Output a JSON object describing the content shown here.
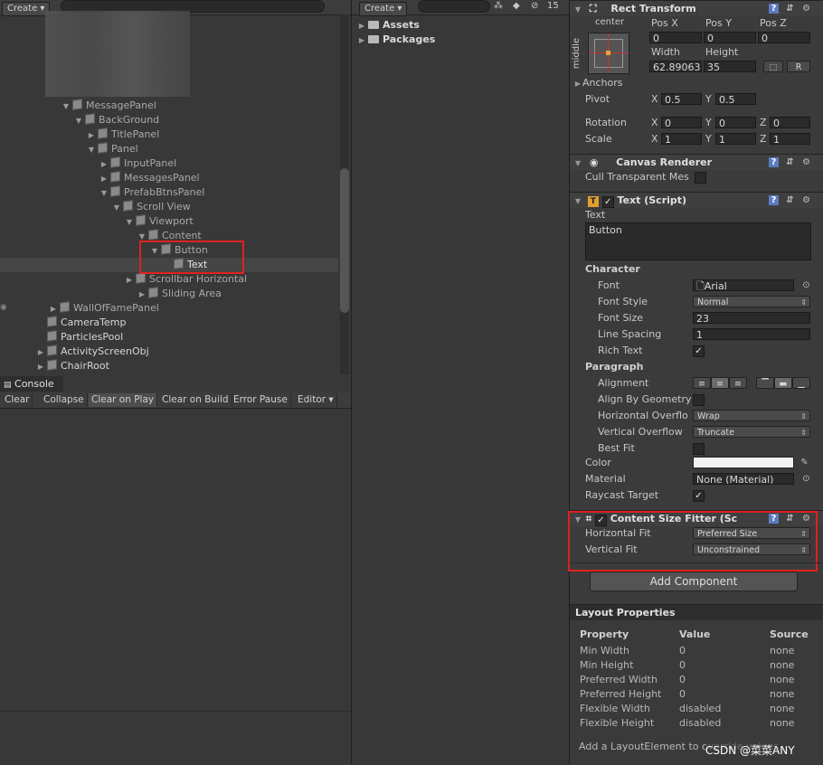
{
  "hierarchy": {
    "create_label": "Create",
    "items": [
      {
        "label": "MessagePanel",
        "indent": 0,
        "tri": "▼"
      },
      {
        "label": "BackGround",
        "indent": 1,
        "tri": "▼"
      },
      {
        "label": "TitlePanel",
        "indent": 2,
        "tri": "▶"
      },
      {
        "label": "Panel",
        "indent": 2,
        "tri": "▼"
      },
      {
        "label": "InputPanel",
        "indent": 3,
        "tri": "▶"
      },
      {
        "label": "MessagesPanel",
        "indent": 3,
        "tri": "▶"
      },
      {
        "label": "PrefabBtnsPanel",
        "indent": 3,
        "tri": "▼"
      },
      {
        "label": "Scroll View",
        "indent": 4,
        "tri": "▼"
      },
      {
        "label": "Viewport",
        "indent": 5,
        "tri": "▼"
      },
      {
        "label": "Content",
        "indent": 6,
        "tri": "▼"
      },
      {
        "label": "Button",
        "indent": 7,
        "tri": "▼"
      },
      {
        "label": "Text",
        "indent": 8,
        "tri": ""
      },
      {
        "label": "Scrollbar Horizontal",
        "indent": 5,
        "tri": "▶"
      },
      {
        "label": "Sliding Area",
        "indent": 6,
        "tri": "▶"
      },
      {
        "label": "WallOfFamePanel",
        "indent": -1,
        "tri": "▶"
      },
      {
        "label": "CameraTemp",
        "indent": -2,
        "tri": ""
      },
      {
        "label": "ParticlesPool",
        "indent": -2,
        "tri": ""
      },
      {
        "label": "ActivityScreenObj",
        "indent": -2,
        "tri": "▶"
      },
      {
        "label": "ChairRoot",
        "indent": -2,
        "tri": "▶"
      }
    ]
  },
  "console": {
    "tab_label": "Console",
    "buttons": [
      "Clear",
      "Collapse",
      "Clear on Play",
      "Clear on Build",
      "Error Pause",
      "Editor ▾"
    ]
  },
  "project": {
    "create_label": "Create",
    "hidden_count": "15",
    "items": [
      "Assets",
      "Packages"
    ]
  },
  "inspector": {
    "rect_transform": {
      "title": "Rect Transform",
      "anchor_h": "center",
      "anchor_v": "middle",
      "pos_x_label": "Pos X",
      "pos_y_label": "Pos Y",
      "pos_z_label": "Pos Z",
      "pos_x": "0",
      "pos_y": "0",
      "pos_z": "0",
      "width_label": "Width",
      "height_label": "Height",
      "width": "62.89063",
      "height": "35",
      "r_label": "R",
      "anchors_label": "Anchors",
      "pivot_label": "Pivot",
      "pivot_x": "0.5",
      "pivot_y": "0.5",
      "rotation_label": "Rotation",
      "rot_x": "0",
      "rot_y": "0",
      "rot_z": "0",
      "scale_label": "Scale",
      "scale_x": "1",
      "scale_y": "1",
      "scale_z": "1",
      "x": "X",
      "y": "Y",
      "z": "Z"
    },
    "canvas_renderer": {
      "title": "Canvas Renderer",
      "cull_label": "Cull Transparent Mes"
    },
    "text_script": {
      "title": "Text (Script)",
      "text_label": "Text",
      "text_value": "Button",
      "character_label": "Character",
      "font_label": "Font",
      "font_value": "Arial",
      "font_style_label": "Font Style",
      "font_style_value": "Normal",
      "font_size_label": "Font Size",
      "font_size_value": "23",
      "line_spacing_label": "Line Spacing",
      "line_spacing_value": "1",
      "rich_text_label": "Rich Text",
      "paragraph_label": "Paragraph",
      "alignment_label": "Alignment",
      "align_geometry_label": "Align By Geometry",
      "h_overflow_label": "Horizontal Overflo",
      "h_overflow_value": "Wrap",
      "v_overflow_label": "Vertical Overflow",
      "v_overflow_value": "Truncate",
      "best_fit_label": "Best Fit",
      "color_label": "Color",
      "material_label": "Material",
      "material_value": "None (Material)",
      "raycast_label": "Raycast Target"
    },
    "content_size_fitter": {
      "title": "Content Size Fitter (Sc",
      "h_fit_label": "Horizontal Fit",
      "h_fit_value": "Preferred Size",
      "v_fit_label": "Vertical Fit",
      "v_fit_value": "Unconstrained"
    },
    "add_component_label": "Add Component",
    "colors": {
      "accent_red": "#e02020"
    }
  },
  "layout_properties": {
    "title": "Layout Properties",
    "headers": [
      "Property",
      "Value",
      "Source"
    ],
    "rows": [
      [
        "Min Width",
        "0",
        "none"
      ],
      [
        "Min Height",
        "0",
        "none"
      ],
      [
        "Preferred Width",
        "0",
        "none"
      ],
      [
        "Preferred Height",
        "0",
        "none"
      ],
      [
        "Flexible Width",
        "disabled",
        "none"
      ],
      [
        "Flexible Height",
        "disabled",
        "none"
      ]
    ],
    "footer": "Add a LayoutElement to override values.",
    "watermark": "CSDN @菜菜ANY"
  }
}
